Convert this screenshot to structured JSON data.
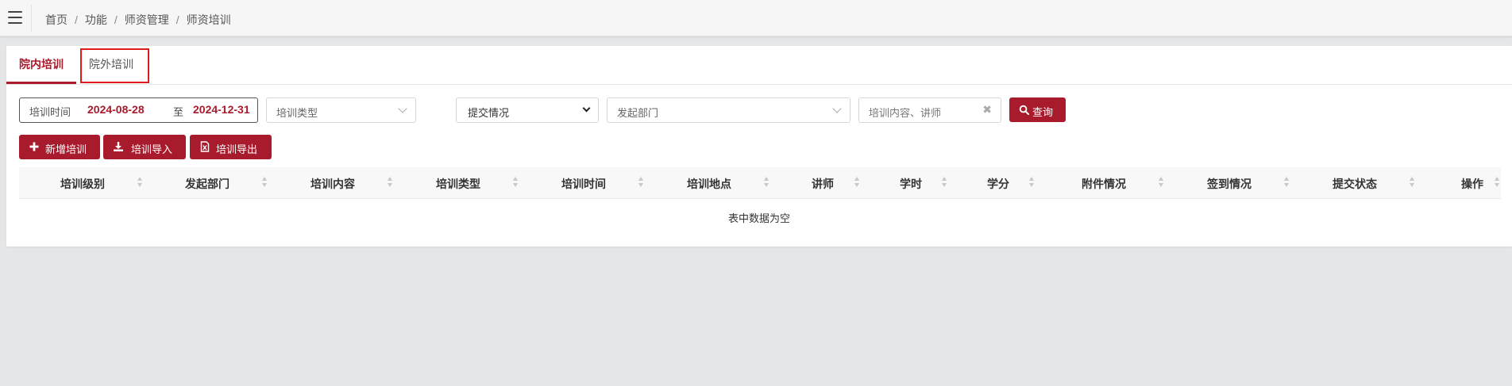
{
  "breadcrumb": [
    "首页",
    "功能",
    "师资管理",
    "师资培训"
  ],
  "tabs": [
    {
      "label": "院内培训",
      "active": true
    },
    {
      "label": "院外培训",
      "active": false
    }
  ],
  "filters": {
    "date_label": "培训时间",
    "date_start": "2024-08-28",
    "date_to": "至",
    "date_end": "2024-12-31",
    "training_type_placeholder": "培训类型",
    "submit_status_value": "提交情况",
    "department_placeholder": "发起部门",
    "keyword_placeholder": "培训内容、讲师",
    "search_label": "查询"
  },
  "actions": {
    "add_label": "新增培训",
    "import_label": "培训导入",
    "export_label": "培训导出"
  },
  "table": {
    "columns": [
      "培训级别",
      "发起部门",
      "培训内容",
      "培训类型",
      "培训时间",
      "培训地点",
      "讲师",
      "学时",
      "学分",
      "附件情况",
      "签到情况",
      "提交状态",
      "操作"
    ],
    "rows": [],
    "empty_text": "表中数据为空"
  },
  "colors": {
    "accent": "#a81b2c",
    "highlight": "#e0191d",
    "background": "#e5e6e8"
  },
  "icons": [
    "menu-icon",
    "plus-icon",
    "download-icon",
    "excel-file-icon",
    "search-icon",
    "close-icon",
    "chevron-down-icon",
    "sort-icon"
  ]
}
